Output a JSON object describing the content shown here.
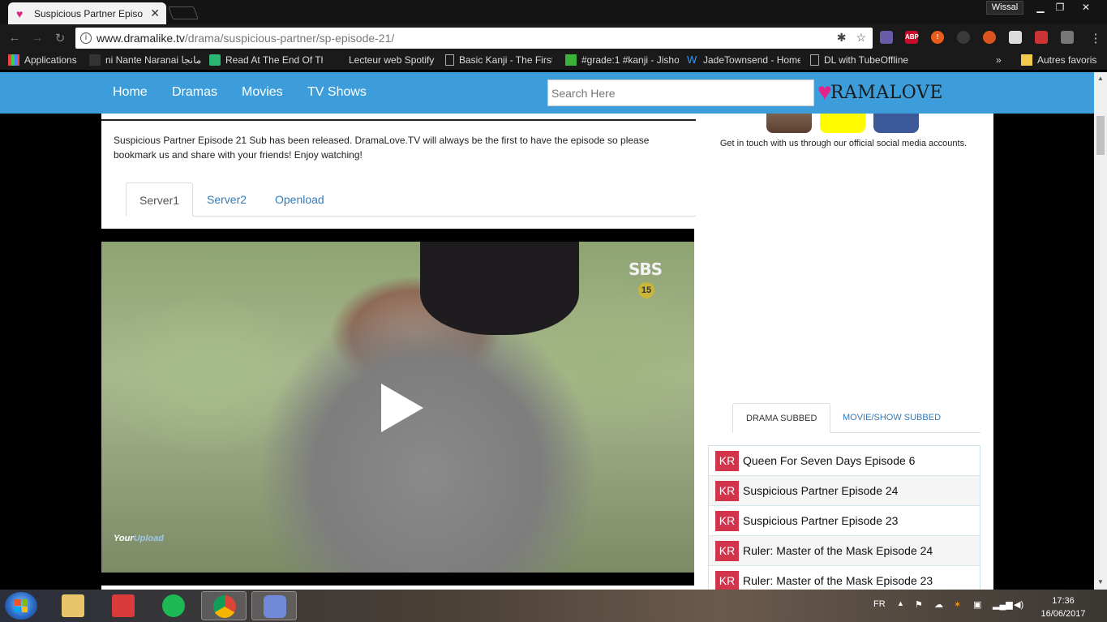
{
  "browser": {
    "tab_title": "Suspicious Partner Episo",
    "profile_name": "Wissal",
    "url_host": "www.dramalike.tv",
    "url_path": "/drama/suspicious-partner/sp-episode-21/",
    "extensions": [
      {
        "name": "abp-icon",
        "label": "ABP",
        "badge": "9",
        "color": "#c70d2c"
      },
      {
        "name": "warning-icon",
        "label": "!",
        "color": "#e85c1c"
      }
    ],
    "bookmarks": [
      {
        "label": "Applications",
        "icon": "apps-grid-icon"
      },
      {
        "label": "ni Nante Naranai مانجا",
        "icon": "manga-icon"
      },
      {
        "label": "Read At The End Of Th",
        "icon": "book-icon"
      },
      {
        "label": "Lecteur web Spotify",
        "icon": "spotify-icon"
      },
      {
        "label": "Basic Kanji - The First",
        "icon": "page-icon"
      },
      {
        "label": "#grade:1 #kanji - Jisho",
        "icon": "jisho-icon"
      },
      {
        "label": "JadeTownsend - Home",
        "icon": "wordpress-icon"
      },
      {
        "label": "DL with TubeOffline",
        "icon": "page-icon"
      }
    ],
    "bookmarks_overflow": "»",
    "other_bookmarks": "Autres favoris"
  },
  "site": {
    "nav": [
      "Home",
      "Dramas",
      "Movies",
      "TV Shows"
    ],
    "search_placeholder": "Search Here",
    "logo_text": "RAMALOVE",
    "brand_color": "#3c9dda"
  },
  "main": {
    "description": "Suspicious Partner Episode 21 Sub has been released. DramaLove.TV will always be the first to have the episode so please bookmark us and share with your friends! Enjoy watching!",
    "server_tabs": [
      "Server1",
      "Server2",
      "Openload"
    ],
    "active_server": "Server1",
    "video": {
      "channel_logo": "SBS",
      "age_rating": "15",
      "watermark_a": "Your",
      "watermark_b": "Upload"
    }
  },
  "sidebar": {
    "contact_text": "Get in touch with us through our official social media accounts.",
    "tabs": [
      "DRAMA SUBBED",
      "MOVIE/SHOW SUBBED"
    ],
    "episodes": [
      {
        "country": "KR",
        "title": "Queen For Seven Days Episode 6"
      },
      {
        "country": "KR",
        "title": "Suspicious Partner Episode 24"
      },
      {
        "country": "KR",
        "title": "Suspicious Partner Episode 23"
      },
      {
        "country": "KR",
        "title": "Ruler: Master of the Mask Episode 24"
      },
      {
        "country": "KR",
        "title": "Ruler: Master of the Mask Episode 23"
      }
    ]
  },
  "taskbar": {
    "language": "FR",
    "time": "17:36",
    "date": "16/06/2017"
  }
}
